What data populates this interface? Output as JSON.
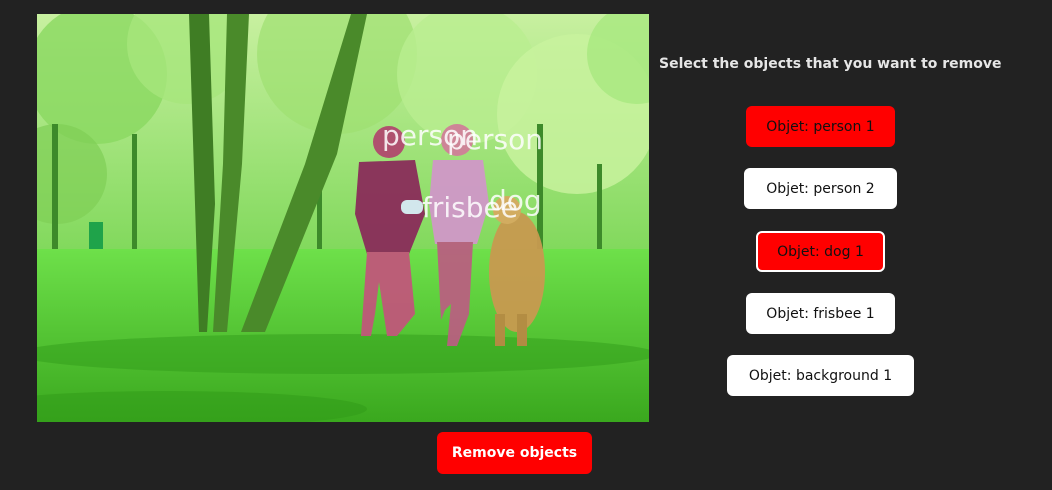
{
  "instructions": "Select the objects that you want to remove",
  "objects": [
    {
      "label": "Objet: person 1",
      "selected": true
    },
    {
      "label": "Objet: person 2",
      "selected": false
    },
    {
      "label": "Objet: dog 1",
      "selected": true
    },
    {
      "label": "Objet: frisbee 1",
      "selected": false
    },
    {
      "label": "Objet: background 1",
      "selected": false
    }
  ],
  "remove_button": "Remove objects",
  "image_labels": {
    "person_1": "person",
    "person_2": "person",
    "frisbee": "frisbee",
    "dog": "dog"
  },
  "colors": {
    "background": "#222222",
    "selected": "#ff0000",
    "unselected": "#ffffff",
    "mask_overlay": "#5bd03a"
  }
}
